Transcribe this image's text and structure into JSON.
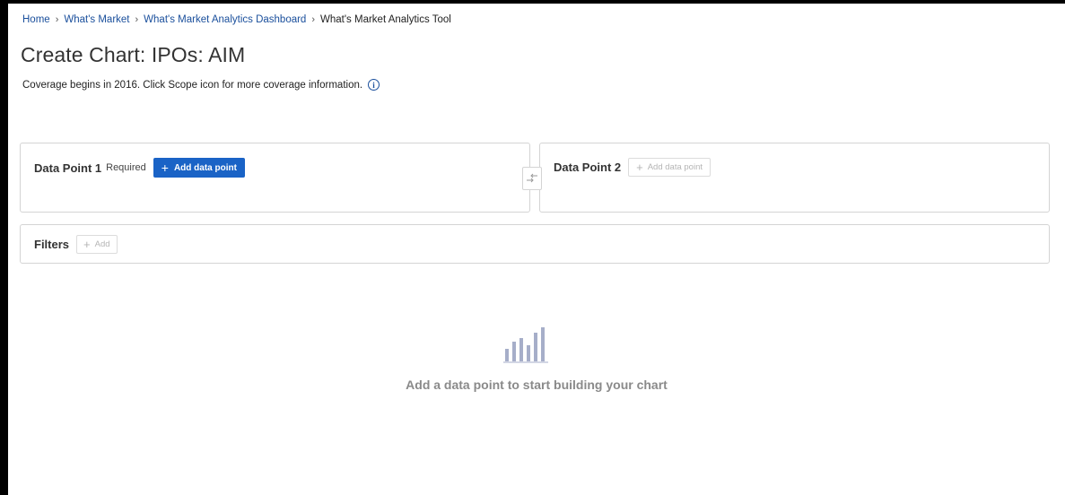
{
  "breadcrumb": {
    "items": [
      "Home",
      "What's Market",
      "What's Market Analytics Dashboard"
    ],
    "current": "What's Market Analytics Tool",
    "separator": "›"
  },
  "page_title": "Create Chart: IPOs: AIM",
  "subtitle": "Coverage begins in 2016. Click Scope icon for more coverage information.",
  "info_icon_glyph": "i",
  "data_point_1": {
    "title": "Data Point 1",
    "required_label": "Required",
    "add_button_label": "Add data point"
  },
  "data_point_2": {
    "title": "Data Point 2",
    "add_button_label": "Add data point"
  },
  "filters": {
    "title": "Filters",
    "add_button_label": "Add"
  },
  "empty_state": {
    "message": "Add a data point to start building your chart",
    "icon": "bar-chart-icon"
  },
  "icons": {
    "plus": "+",
    "swap": "swap-arrows-icon",
    "info": "info-icon"
  },
  "colors": {
    "link": "#1a4f9c",
    "primary_button": "#1a63c6",
    "empty_icon": "#a6aec9",
    "empty_text": "#8a8a8a",
    "border": "#d4d4d4"
  }
}
